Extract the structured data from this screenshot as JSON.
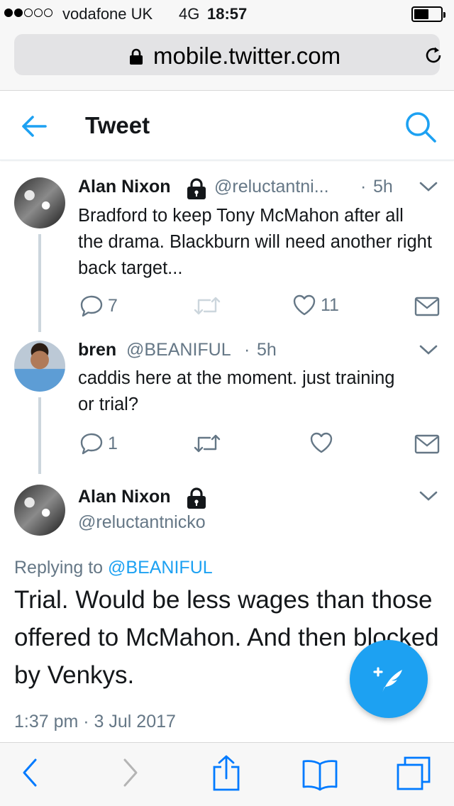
{
  "status_bar": {
    "carrier": "vodafone UK",
    "network": "4G",
    "time": "18:57",
    "signal_bars_filled": 2,
    "signal_bars_total": 5,
    "battery_level": 0.5
  },
  "browser": {
    "url": "mobile.twitter.com"
  },
  "header": {
    "title": "Tweet"
  },
  "tweets": [
    {
      "name": "Alan Nixon",
      "handle": "@reluctantni...",
      "separator": "·",
      "time": "5h",
      "text": "Bradford to keep Tony McMahon after all the drama. Blackburn will need another right back target...",
      "replies": "7",
      "likes": "11"
    },
    {
      "name": "bren",
      "handle": "@BEANIFUL",
      "separator": "·",
      "time": "5h",
      "text": "caddis here at the moment. just training or trial?",
      "replies": "1"
    }
  ],
  "focused_tweet": {
    "name": "Alan Nixon",
    "handle": "@reluctantnicko",
    "replying_prefix": "Replying to",
    "replying_to": "@BEANIFUL",
    "text": "Trial. Would be less wages than those offered to McMahon. And then blocked by Venkys.",
    "timestamp": "1:37 pm · 3 Jul 2017"
  },
  "colors": {
    "accent": "#1da1f2",
    "secondary_text": "#657786",
    "thread_line": "#ccd6dd",
    "safari_blue": "#007aff"
  },
  "icons": {
    "back": "arrow-left-icon",
    "search": "search-icon",
    "reply": "speech-bubble-icon",
    "retweet": "retweet-icon",
    "like": "heart-icon",
    "dm": "envelope-icon",
    "compose": "feather-plus-icon"
  }
}
